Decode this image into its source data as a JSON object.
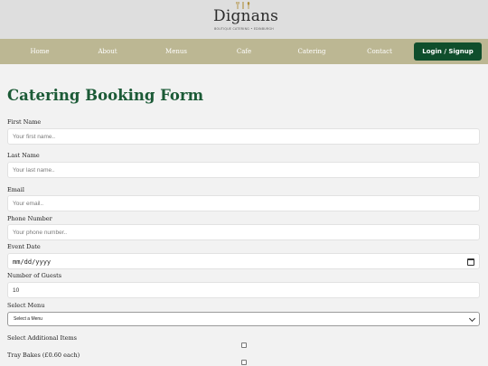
{
  "brand": {
    "name": "Dignans",
    "tagline": "BOUTIQUE CATERING • EDINBURGH"
  },
  "nav": {
    "items": [
      {
        "label": "Home"
      },
      {
        "label": "About"
      },
      {
        "label": "Menus"
      },
      {
        "label": "Cafe"
      },
      {
        "label": "Catering"
      },
      {
        "label": "Contact"
      }
    ],
    "login_label": "Login / Signup"
  },
  "form": {
    "title": "Catering Booking Form",
    "first_name": {
      "label": "First Name",
      "placeholder": "Your first name..",
      "value": ""
    },
    "last_name": {
      "label": "Last Name",
      "placeholder": "Your last name..",
      "value": ""
    },
    "email": {
      "label": "Email",
      "placeholder": "Your email..",
      "value": ""
    },
    "phone": {
      "label": "Phone Number",
      "placeholder": "Your phone number..",
      "value": ""
    },
    "event_date": {
      "label": "Event Date",
      "placeholder": "mm/dd/yyyy"
    },
    "guests": {
      "label": "Number of Guests",
      "value": "10"
    },
    "menu": {
      "label": "Select Menu",
      "selected": "Select a Menu"
    },
    "additional": {
      "label": "Select Additional Items",
      "items": [
        {
          "label": "",
          "checked": false
        },
        {
          "label": "Tray Bakes (£0.60 each)",
          "checked": false
        }
      ]
    }
  },
  "colors": {
    "header_bg": "#dedede",
    "nav_bg": "#bcb793",
    "accent_green": "#0f4e2c",
    "title_green": "#1b5a36",
    "page_bg": "#f2f2f2"
  }
}
